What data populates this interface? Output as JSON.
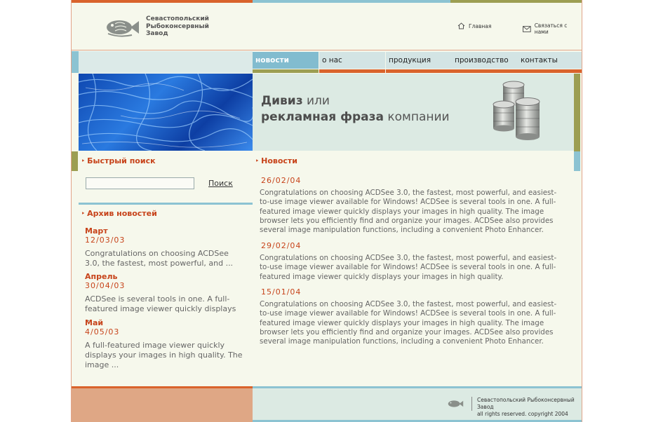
{
  "header": {
    "company_name_lines": [
      "Севастопольский",
      "Рыбоконсервный",
      "Завод"
    ],
    "home_link": "Главная",
    "contact_link": "Связаться с нами"
  },
  "nav": {
    "items": [
      {
        "label": "новости",
        "active": true
      },
      {
        "label": "о нас",
        "active": false
      },
      {
        "label": "продукция",
        "active": false
      },
      {
        "label": "производство",
        "active": false
      },
      {
        "label": "контакты",
        "active": false
      }
    ]
  },
  "banner": {
    "line1_bold": "Дивиз",
    "line1_rest": " или",
    "line2_bold": "рекламная фраза",
    "line2_rest": " компании"
  },
  "search": {
    "title": "Быстрый поиск",
    "input_value": "",
    "button_label": "Поиск"
  },
  "archive": {
    "title": "Архив новостей",
    "entries": [
      {
        "month": "Март",
        "date": "12/03/03",
        "text": "Congratulations on choosing ACDSee 3.0, the fastest, most powerful, and ..."
      },
      {
        "month": "Апрель",
        "date": "30/04/03",
        "text": "ACDSee is several tools in one. A full-featured image viewer quickly displays ..."
      },
      {
        "month": "Май",
        "date": "4/05/03",
        "text": "A full-featured image viewer quickly displays your images in high quality.  The image ..."
      }
    ]
  },
  "news": {
    "title": "Новости",
    "items": [
      {
        "date": "26/02/04",
        "text": "Congratulations on choosing ACDSee 3.0, the fastest, most powerful, and easiest-to-use image viewer available for Windows!   ACDSee is several tools in one. A full-featured image viewer quickly displays your images in high quality.  The image browser lets you efficiently find and organize your images.  ACDSee also provides several image manipulation functions, including a convenient Photo Enhancer."
      },
      {
        "date": "29/02/04",
        "text": "Congratulations on choosing ACDSee 3.0, the fastest, most powerful, and easiest-to-use image viewer available for Windows!   ACDSee is several tools in one. A full-featured image viewer quickly displays your images in high quality."
      },
      {
        "date": "15/01/04",
        "text": "Congratulations on choosing ACDSee 3.0, the fastest, most powerful, and easiest-to-use image viewer available for Windows!   ACDSee is several tools in one. A full-featured image viewer quickly displays your images in high quality.  The image browser lets you efficiently find and organize your images.  ACDSee also provides several image manipulation functions, including a convenient Photo Enhancer."
      }
    ]
  },
  "footer": {
    "company": "Севастопольский Рыбоконсервный Завод",
    "rights": "all rights reserved. copyright 2004"
  },
  "colors": {
    "accent_orange": "#d9632c",
    "accent_blue": "#8cc3d2",
    "accent_olive": "#9c9e52",
    "text_red": "#c7431a",
    "page_bg": "#f6f8ec"
  }
}
